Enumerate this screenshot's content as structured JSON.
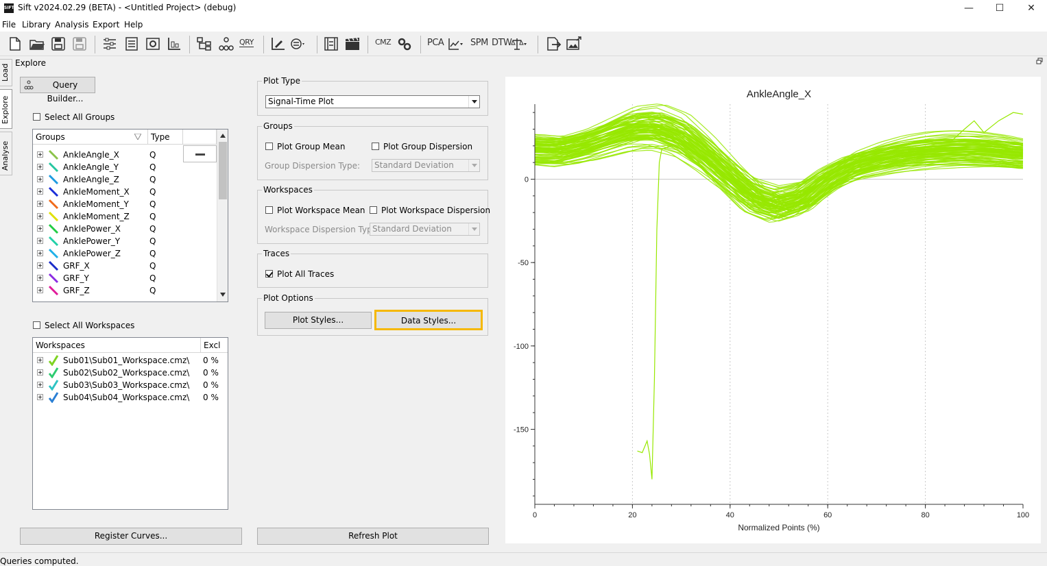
{
  "window": {
    "title": "Sift v2024.02.29 (BETA) - <Untitled Project> (debug)",
    "logo_text": "SIFT",
    "minimize": "—",
    "maximize": "☐",
    "close": "✕"
  },
  "menu": [
    "File",
    "Library",
    "Analysis",
    "Export",
    "Help"
  ],
  "toolbar": {
    "texts": [
      "CMZ",
      "QRY",
      "PCA",
      "SPM",
      "DTW"
    ]
  },
  "side_tabs": [
    "Load",
    "Explore",
    "Analyse"
  ],
  "explore": {
    "title": "Explore",
    "query_builder": "Query Builder...",
    "select_all_groups": "Select All Groups",
    "groups_header": "Groups",
    "type_header": "Type",
    "groups": [
      {
        "name": "AnkleAngle_X",
        "type": "Q",
        "color": "#8bc34a"
      },
      {
        "name": "AnkleAngle_Y",
        "type": "Q",
        "color": "#26c6a0"
      },
      {
        "name": "AnkleAngle_Z",
        "type": "Q",
        "color": "#1e9be0"
      },
      {
        "name": "AnkleMoment_X",
        "type": "Q",
        "color": "#1b2fd8"
      },
      {
        "name": "AnkleMoment_Y",
        "type": "Q",
        "color": "#f06a1a"
      },
      {
        "name": "AnkleMoment_Z",
        "type": "Q",
        "color": "#e0e000"
      },
      {
        "name": "AnklePower_X",
        "type": "Q",
        "color": "#22cc44"
      },
      {
        "name": "AnklePower_Y",
        "type": "Q",
        "color": "#22d0a8"
      },
      {
        "name": "AnklePower_Z",
        "type": "Q",
        "color": "#1fb0e8"
      },
      {
        "name": "GRF_X",
        "type": "Q",
        "color": "#1a2cc8"
      },
      {
        "name": "GRF_Y",
        "type": "Q",
        "color": "#8a2be2"
      },
      {
        "name": "GRF_Z",
        "type": "Q",
        "color": "#e01a9a"
      }
    ],
    "select_all_workspaces": "Select All Workspaces",
    "workspaces_header": "Workspaces",
    "excl_header": "Excl",
    "workspaces": [
      {
        "name": "Sub01\\Sub01_Workspace.cmz\\",
        "excl": "0 %",
        "color": "#7ed321"
      },
      {
        "name": "Sub02\\Sub02_Workspace.cmz\\",
        "excl": "0 %",
        "color": "#2ecc71"
      },
      {
        "name": "Sub03\\Sub03_Workspace.cmz\\",
        "excl": "0 %",
        "color": "#2ec4c4"
      },
      {
        "name": "Sub04\\Sub04_Workspace.cmz\\",
        "excl": "0 %",
        "color": "#2a7fd4"
      }
    ],
    "register_curves": "Register Curves..."
  },
  "options": {
    "plot_type_title": "Plot Type",
    "plot_type_value": "Signal-Time Plot",
    "groups_title": "Groups",
    "plot_group_mean": "Plot Group Mean",
    "plot_group_dispersion": "Plot Group Dispersion",
    "group_dispersion_type_label": "Group Dispersion Type:",
    "group_dispersion_type_value": "Standard Deviation",
    "workspaces_title": "Workspaces",
    "plot_workspace_mean": "Plot Workspace Mean",
    "plot_workspace_dispersion": "Plot Workspace Dispersion",
    "workspace_dispersion_type_label": "Workspace Dispersion Type:",
    "workspace_dispersion_type_value": "Standard Deviation",
    "traces_title": "Traces",
    "plot_all_traces": "Plot All Traces",
    "plot_options_title": "Plot Options",
    "plot_styles": "Plot Styles...",
    "data_styles": "Data Styles...",
    "refresh_plot": "Refresh Plot",
    "highlight_color": "#f5b800"
  },
  "status": "Queries computed.",
  "chart_data": {
    "type": "line",
    "title": "AnkleAngle_X",
    "xlabel": "Normalized Points (%)",
    "ylabel": "",
    "xlim": [
      0,
      100
    ],
    "ylim": [
      -195,
      45
    ],
    "x_ticks": [
      0,
      20,
      40,
      60,
      80,
      100
    ],
    "y_ticks": [
      0,
      -50,
      -100,
      -150
    ],
    "grid": true,
    "color": "#97e800",
    "mean_curve": [
      [
        0,
        18
      ],
      [
        5,
        17
      ],
      [
        10,
        20
      ],
      [
        15,
        25
      ],
      [
        20,
        30
      ],
      [
        25,
        31
      ],
      [
        30,
        26
      ],
      [
        35,
        15
      ],
      [
        40,
        2
      ],
      [
        45,
        -10
      ],
      [
        50,
        -15
      ],
      [
        55,
        -11
      ],
      [
        60,
        0
      ],
      [
        65,
        8
      ],
      [
        70,
        12
      ],
      [
        75,
        15
      ],
      [
        80,
        17
      ],
      [
        85,
        18
      ],
      [
        90,
        18
      ],
      [
        95,
        17
      ],
      [
        100,
        15
      ]
    ],
    "spread": 8,
    "trace_count": 90,
    "outlier": [
      [
        21,
        -163
      ],
      [
        22,
        -164
      ],
      [
        23,
        -157
      ],
      [
        23.5,
        -165
      ],
      [
        24,
        -180
      ],
      [
        24.5,
        -120
      ],
      [
        25,
        -30
      ],
      [
        25.5,
        10
      ],
      [
        26,
        18
      ],
      [
        28,
        20
      ]
    ],
    "upper_outlier": [
      [
        85,
        22
      ],
      [
        88,
        30
      ],
      [
        90,
        35
      ],
      [
        92,
        28
      ],
      [
        95,
        35
      ],
      [
        98,
        40
      ],
      [
        100,
        39
      ]
    ]
  }
}
